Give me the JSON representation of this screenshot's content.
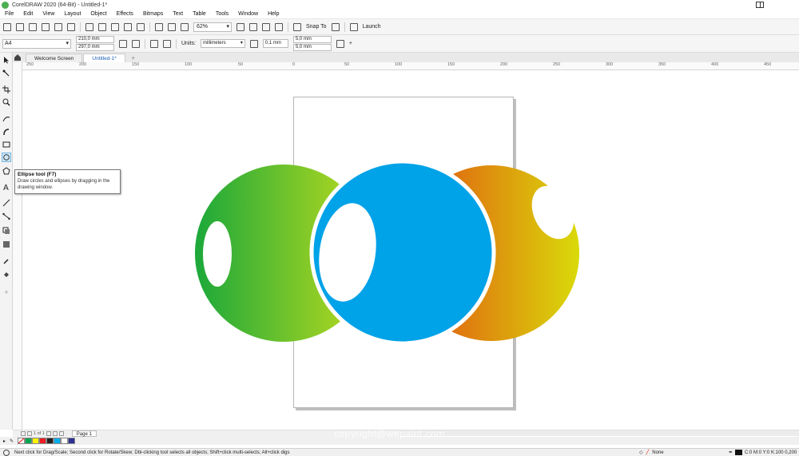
{
  "window": {
    "title": "CorelDRAW 2020 (64-Bit) - Untitled-1*"
  },
  "menu": [
    "File",
    "Edit",
    "View",
    "Layout",
    "Object",
    "Effects",
    "Bitmaps",
    "Text",
    "Table",
    "Tools",
    "Window",
    "Help"
  ],
  "toolbar": {
    "zoom": "62%",
    "snap_label": "Snap To",
    "launch_label": "Launch"
  },
  "propbar": {
    "page_size": "A4",
    "width": "210,0 mm",
    "height": "297,0 mm",
    "units_label": "Units:",
    "units_value": "millimeters",
    "nudge": "0,1 mm",
    "dup_x": "5,0 mm",
    "dup_y": "5,0 mm"
  },
  "tabs": [
    "Welcome Screen",
    "Untitled-1*"
  ],
  "ruler": {
    "labels": [
      "250",
      "200",
      "150",
      "100",
      "50",
      "0",
      "50",
      "100",
      "150",
      "200",
      "250",
      "300",
      "350",
      "400",
      "450"
    ]
  },
  "tooltip": {
    "title": "Ellipse tool (F7)",
    "body": "Draw circles and ellipses by dragging in the drawing window."
  },
  "pagenav": {
    "page_label": "Page 1",
    "page_of": "1 of 1"
  },
  "palette": [
    "#ffffff",
    "#00a651",
    "#fff200",
    "#ed1c24",
    "#231f20",
    "#00aeef",
    "#ffffff",
    "#2e3192"
  ],
  "status": {
    "hint": "Next click for Drag/Scale; Second click for Rotate/Skew; Dbl-clicking tool selects all objects; Shift+click multi-selects; Alt+click digs",
    "fill": "None",
    "color": "C:0 M:0 Y:0 K:100  0,200"
  },
  "watermark": "copyright@wepaint.com",
  "colors": {
    "blue": "#00a2e8",
    "green_start": "#1ba83a",
    "green_end": "#c0dc1e",
    "orange_start": "#e24b12",
    "orange_end": "#d9da0a"
  }
}
